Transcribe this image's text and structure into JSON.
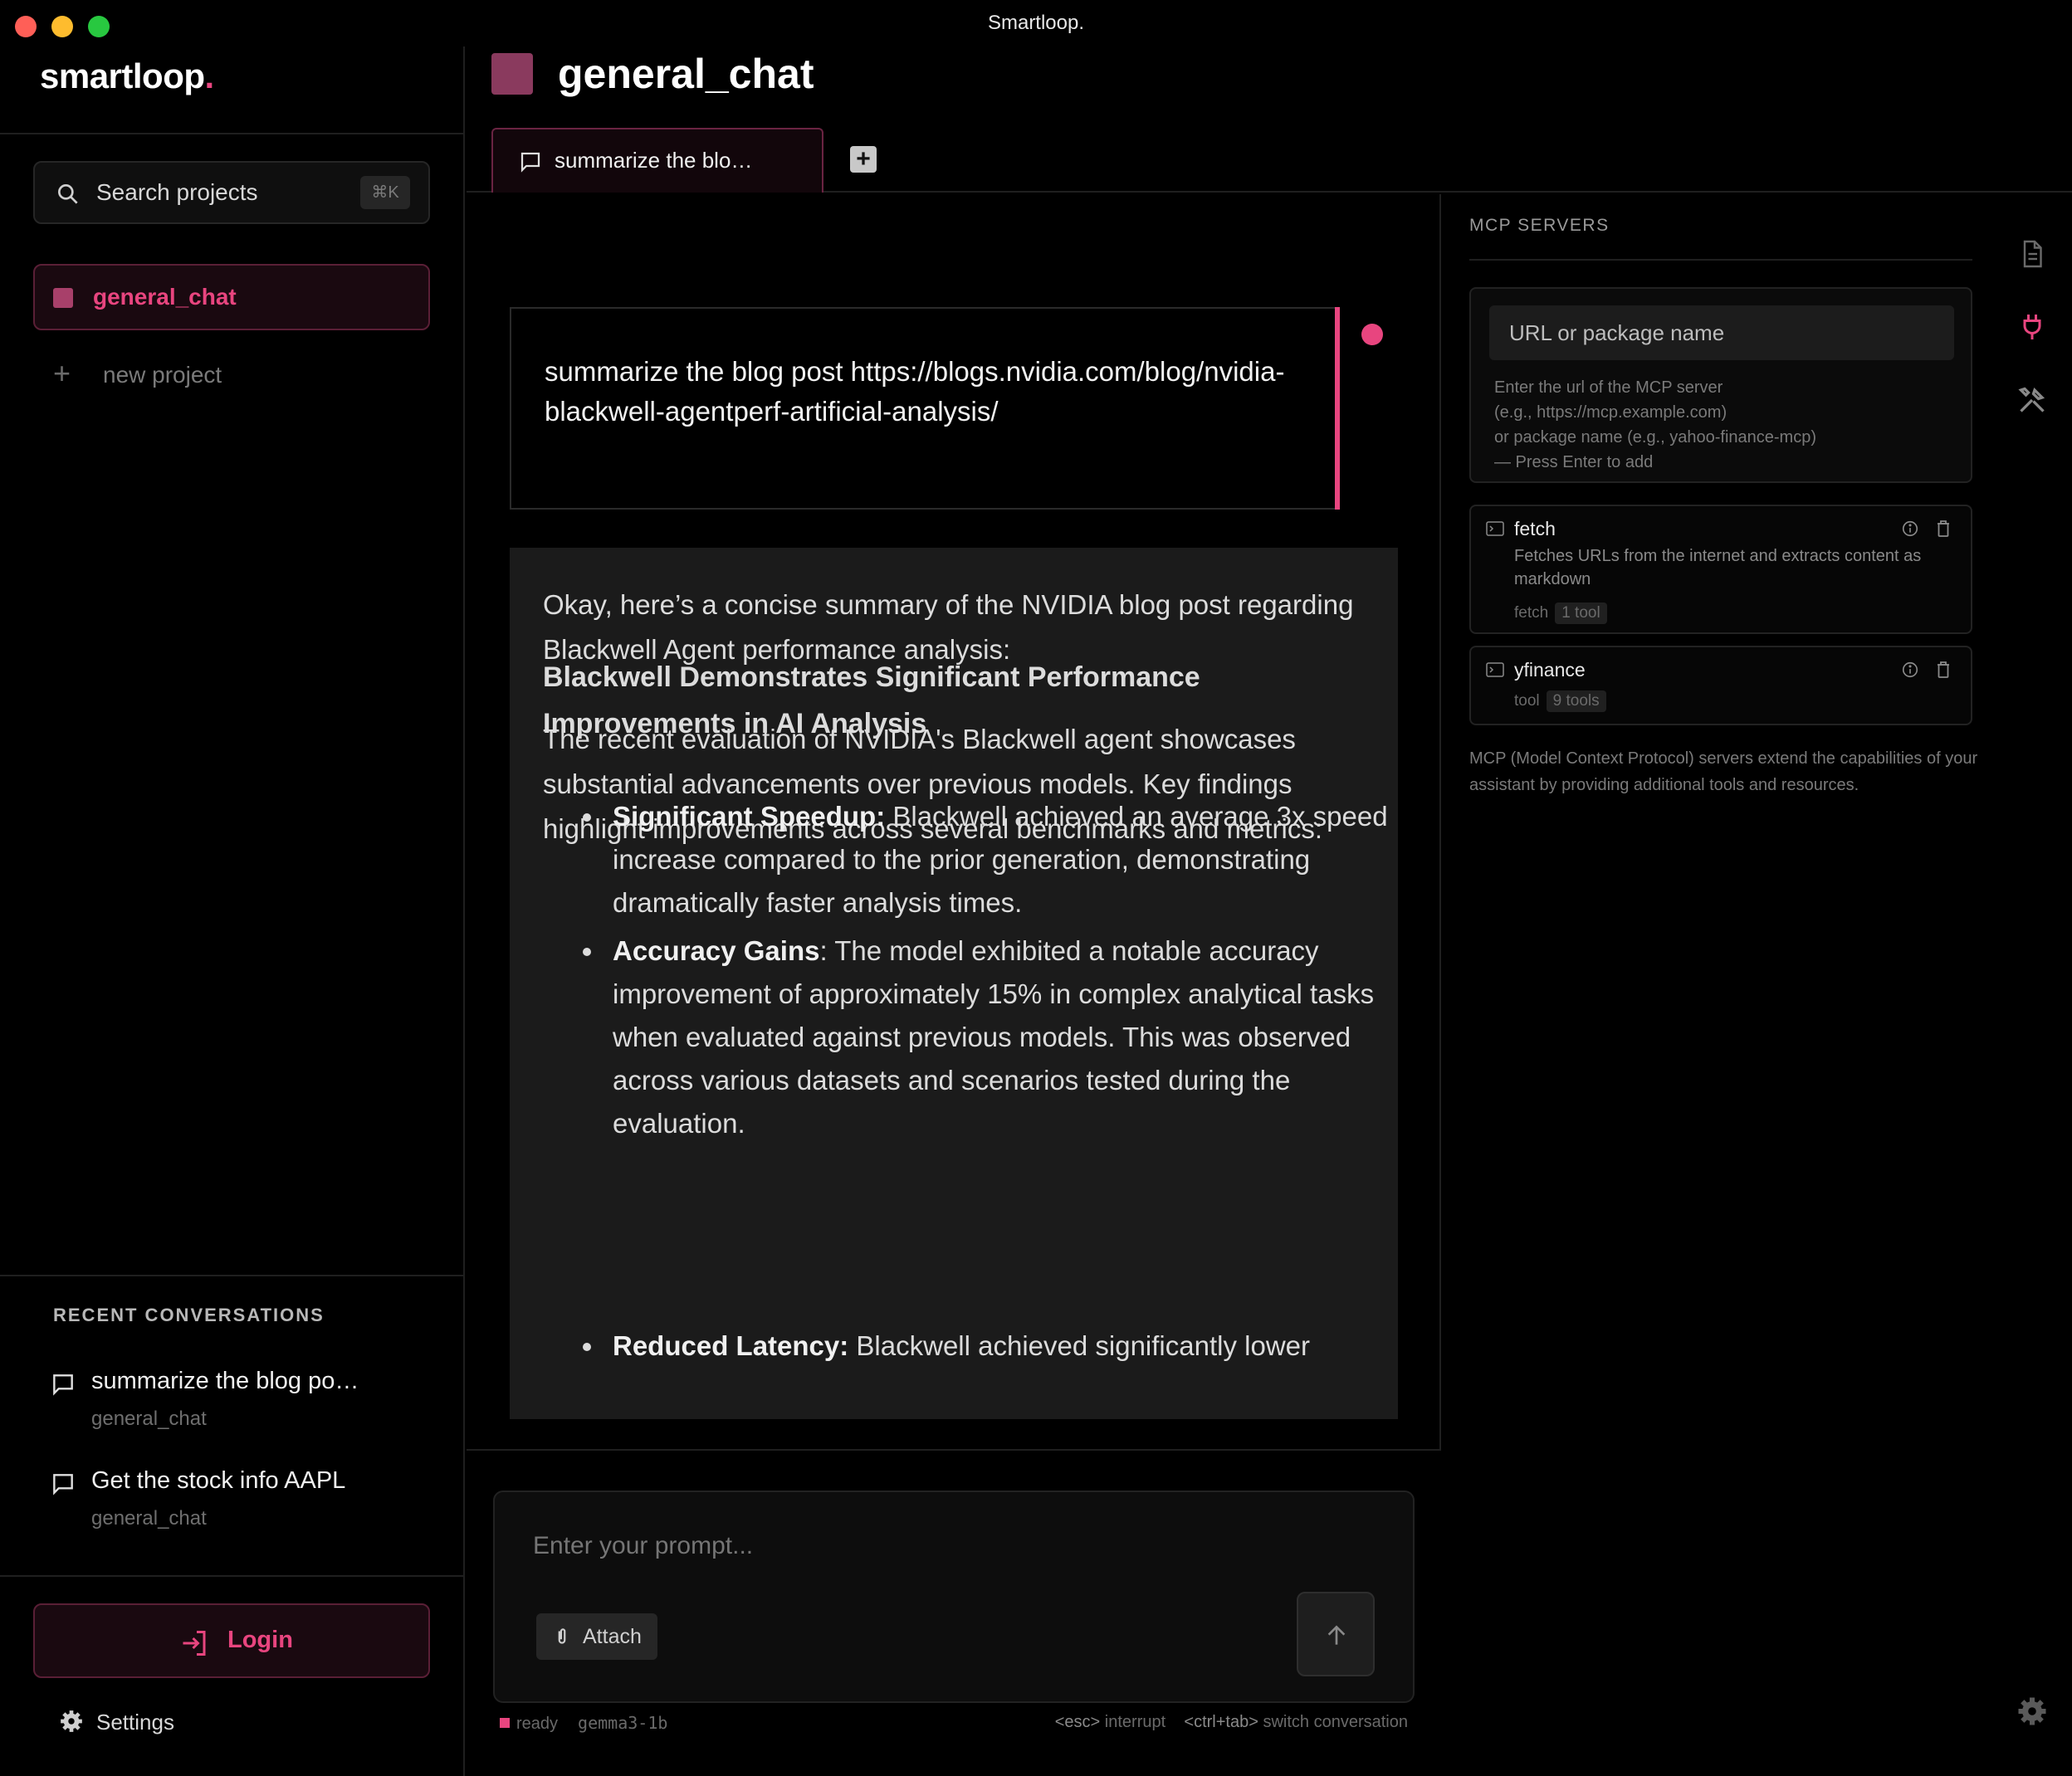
{
  "window": {
    "title": "Smartloop."
  },
  "sidebar": {
    "brand": "smartloop",
    "brand_dot": ".",
    "search": {
      "label": "Search projects",
      "shortcut": "⌘K"
    },
    "projects": [
      {
        "name": "general_chat",
        "active": true
      }
    ],
    "new_project_label": "new project",
    "recent_heading": "RECENT CONVERSATIONS",
    "conversations": [
      {
        "title": "summarize the blog po…",
        "project": "general_chat"
      },
      {
        "title": "Get the stock info AAPL",
        "project": "general_chat"
      }
    ],
    "login_label": "Login",
    "settings_label": "Settings"
  },
  "header": {
    "project_title": "general_chat",
    "tabs": [
      {
        "label": "summarize the blo…",
        "active": true
      }
    ],
    "add_tab_glyph": "+"
  },
  "chat": {
    "user_message": "summarize the blog post https://blogs.nvidia.com/blog/nvidia-blackwell-agentperf-artificial-analysis/",
    "assistant": {
      "intro": "Okay, here’s a concise summary of the NVIDIA blog post regarding Blackwell Agent performance analysis:",
      "heading": "Blackwell Demonstrates Significant Performance Improvements in AI Analysis",
      "paragraph": "The recent evaluation of NVIDIA's Blackwell agent showcases substantial advancements over previous models. Key findings highlight improvements across several benchmarks and metrics:",
      "bullets": [
        {
          "title": "Significant Speedup:",
          "text": " Blackwell achieved an average 3x speed increase compared to the prior generation, demonstrating dramatically faster analysis times."
        },
        {
          "title": "Accuracy Gains",
          "text": ": The model exhibited a notable accuracy improvement of approximately 15% in complex analytical tasks when evaluated against previous models. This was observed across various datasets and scenarios tested during the evaluation."
        },
        {
          "title": "Reduced Latency:",
          "text": " Blackwell achieved significantly lower"
        }
      ]
    }
  },
  "composer": {
    "placeholder": "Enter your prompt...",
    "attach_label": "Attach"
  },
  "status": {
    "state": "ready",
    "model": "gemma3-1b",
    "hint1_key": "<esc>",
    "hint1_text": "interrupt",
    "hint2_key": "<ctrl+tab>",
    "hint2_text": "switch conversation"
  },
  "mcp": {
    "heading": "MCP SERVERS",
    "input_placeholder": "URL or package name",
    "help_lines": [
      "Enter the url of the MCP server",
      "(e.g., https://mcp.example.com)",
      "or package name (e.g., yahoo-finance-mcp)",
      "— Press Enter to add"
    ],
    "servers": [
      {
        "name": "fetch",
        "description": "Fetches URLs from the internet and extracts content as markdown",
        "type": "fetch",
        "tools": "1 tool"
      },
      {
        "name": "yfinance",
        "description": "",
        "type": "tool",
        "tools": "9 tools"
      }
    ],
    "footer": "MCP (Model Context Protocol) servers extend the capabilities of your assistant by providing additional tools and resources."
  },
  "colors": {
    "accent": "#e8457f",
    "project": "#8a3a5e",
    "background": "#000000",
    "panel": "#1b1b1b"
  }
}
